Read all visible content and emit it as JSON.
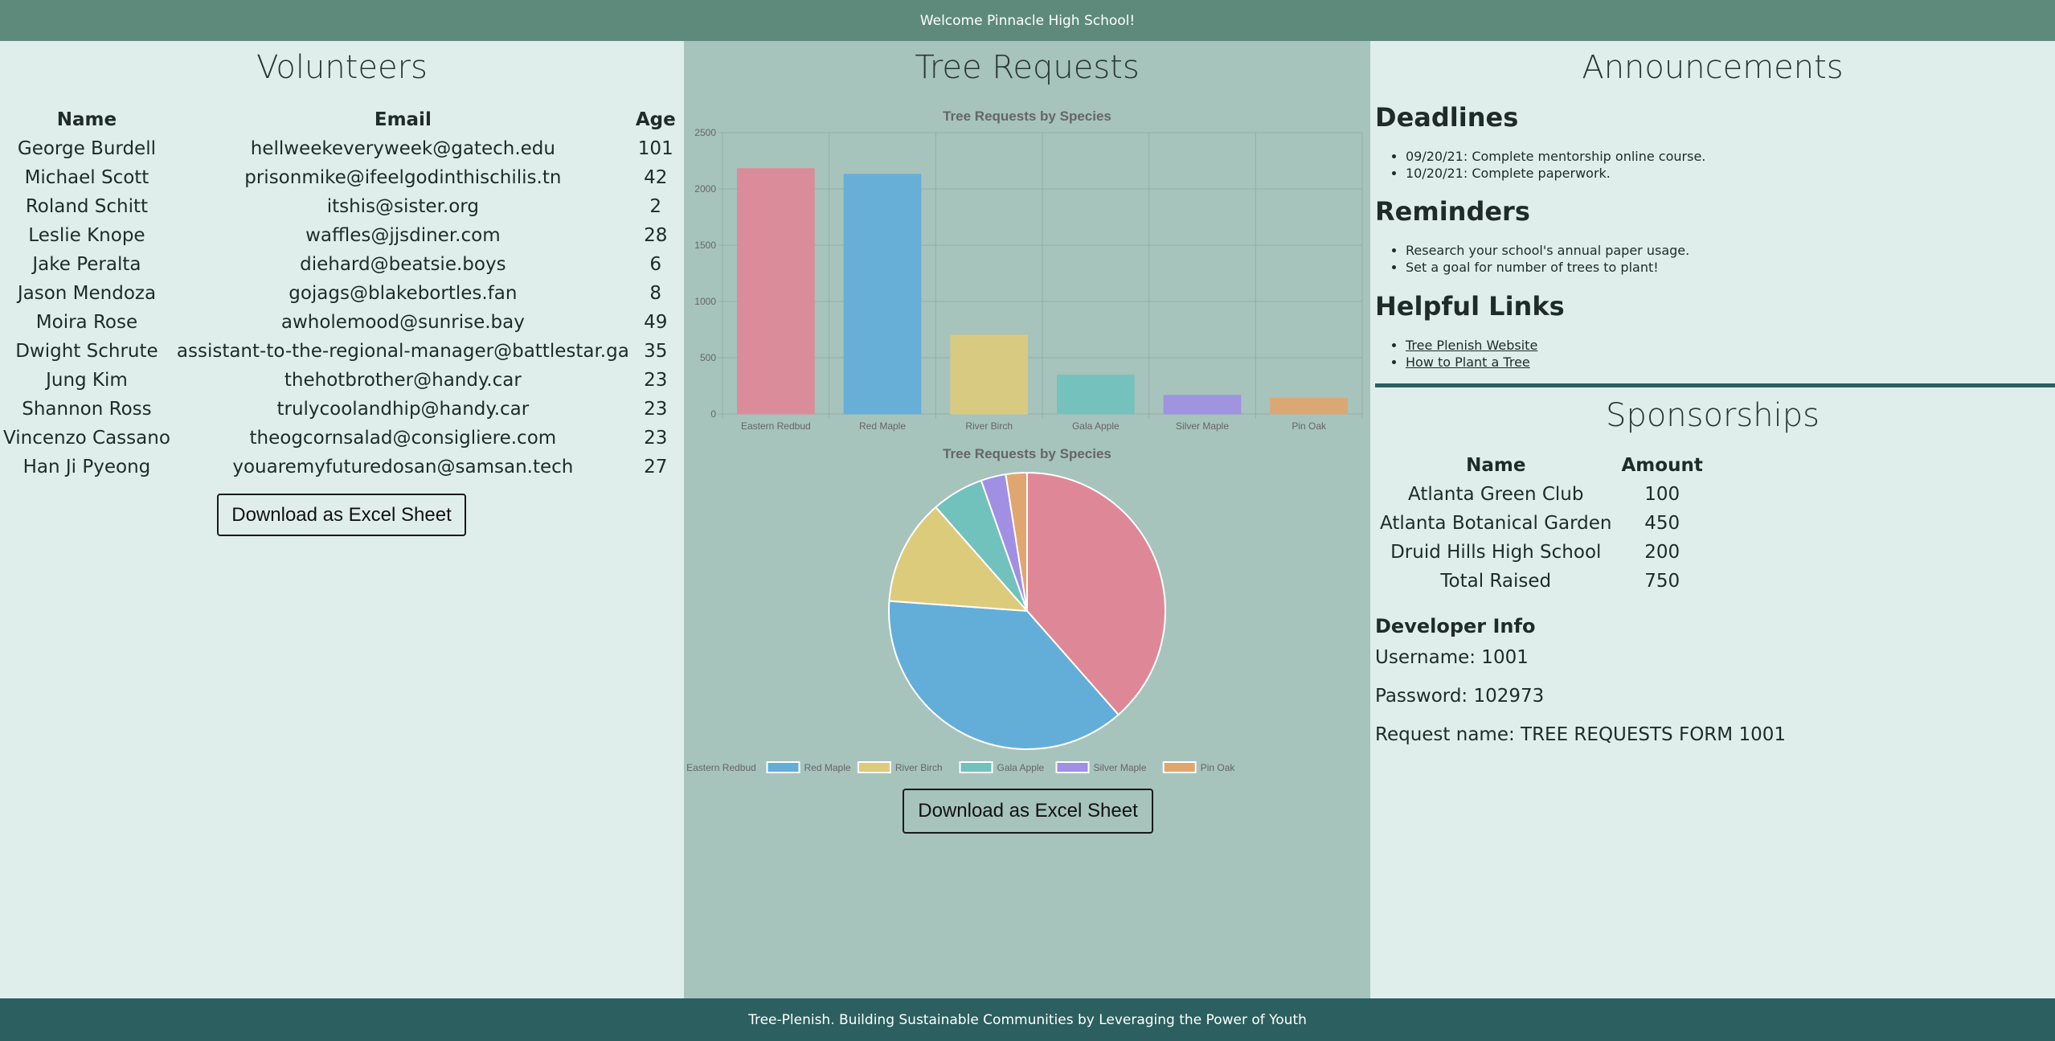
{
  "header": {
    "welcome": "Welcome Pinnacle High School!"
  },
  "footer": {
    "text": "Tree-Plenish. Building Sustainable Communities by Leveraging the Power of Youth"
  },
  "volunteers": {
    "title": "Volunteers",
    "columns": [
      "Name",
      "Email",
      "Age"
    ],
    "rows": [
      [
        "George Burdell",
        "hellweekeveryweek@gatech.edu",
        "101"
      ],
      [
        "Michael Scott",
        "prisonmike@ifeelgodinthischilis.tn",
        "42"
      ],
      [
        "Roland Schitt",
        "itshis@sister.org",
        "2"
      ],
      [
        "Leslie Knope",
        "waffles@jjsdiner.com",
        "28"
      ],
      [
        "Jake Peralta",
        "diehard@beatsie.boys",
        "6"
      ],
      [
        "Jason Mendoza",
        "gojags@blakebortles.fan",
        "8"
      ],
      [
        "Moira Rose",
        "awholemood@sunrise.bay",
        "49"
      ],
      [
        "Dwight Schrute",
        "assistant-to-the-regional-manager@battlestar.ga",
        "35"
      ],
      [
        "Jung Kim",
        "thehotbrother@handy.car",
        "23"
      ],
      [
        "Shannon Ross",
        "trulycoolandhip@handy.car",
        "23"
      ],
      [
        "Vincenzo Cassano",
        "theogcornsalad@consigliere.com",
        "23"
      ],
      [
        "Han Ji Pyeong",
        "youaremyfuturedosan@samsan.tech",
        "27"
      ]
    ],
    "download_label": "Download as Excel Sheet"
  },
  "tree_requests": {
    "title": "Tree Requests",
    "download_label": "Download as Excel Sheet"
  },
  "chart_data": [
    {
      "type": "bar",
      "title": "Tree Requests by Species",
      "categories": [
        "Eastern Redbud",
        "Red Maple",
        "River Birch",
        "Gala Apple",
        "Silver Maple",
        "Pin Oak"
      ],
      "values": [
        2180,
        2130,
        700,
        345,
        165,
        140
      ],
      "ylim": [
        0,
        2500
      ],
      "yticks": [
        0,
        500,
        1000,
        1500,
        2000,
        2500
      ],
      "grid": true,
      "colors": [
        "#de8897",
        "#63aed9",
        "#ddcb7c",
        "#71c1bd",
        "#a08fe3",
        "#dfa66f"
      ]
    },
    {
      "type": "pie",
      "title": "Tree Requests by Species",
      "categories": [
        "Eastern Redbud",
        "Red Maple",
        "River Birch",
        "Gala Apple",
        "Silver Maple",
        "Pin Oak"
      ],
      "values": [
        2180,
        2130,
        700,
        345,
        165,
        140
      ],
      "legend": "bottom",
      "colors": [
        "#de8897",
        "#63aed9",
        "#ddcb7c",
        "#71c1bd",
        "#a08fe3",
        "#dfa66f"
      ]
    }
  ],
  "announcements": {
    "title": "Announcements",
    "deadlines": {
      "heading": "Deadlines",
      "items": [
        "09/20/21: Complete mentorship online course.",
        "10/20/21: Complete paperwork."
      ]
    },
    "reminders": {
      "heading": "Reminders",
      "items": [
        "Research your school's annual paper usage.",
        "Set a goal for number of trees to plant!"
      ]
    },
    "links": {
      "heading": "Helpful Links",
      "items": [
        "Tree Plenish Website",
        "How to Plant a Tree"
      ]
    }
  },
  "sponsorships": {
    "title": "Sponsorships",
    "columns": [
      "Name",
      "Amount"
    ],
    "rows": [
      [
        "Atlanta Green Club",
        "100"
      ],
      [
        "Atlanta Botanical Garden",
        "450"
      ],
      [
        "Druid Hills High School",
        "200"
      ],
      [
        "Total Raised",
        "750"
      ]
    ]
  },
  "developer": {
    "heading": "Developer Info",
    "username": "Username: 1001",
    "password": "Password: 102973",
    "request_name": "Request name: TREE REQUESTS FORM 1001"
  }
}
